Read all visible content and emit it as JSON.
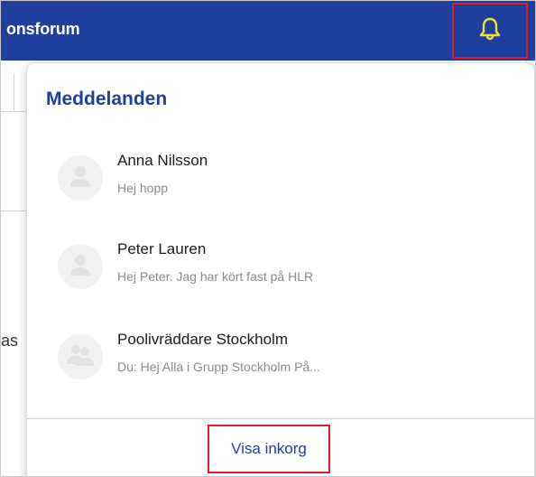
{
  "header": {
    "app_title": "onsforum",
    "bell_icon": "bell-icon",
    "bell_color": "#f5e12a",
    "bar_color": "#1f3f9e"
  },
  "background": {
    "partial_text": "as"
  },
  "notifications": {
    "title": "Meddelanden",
    "items": [
      {
        "name": "Anna Nilsson",
        "preview": "Hej hopp",
        "avatar_icon": "user-icon"
      },
      {
        "name": "Peter Lauren",
        "preview": "Hej Peter. Jag har kört fast på HLR",
        "avatar_icon": "user-icon"
      },
      {
        "name": "Poolivräddare Stockholm",
        "preview": "Du: Hej Alla i Grupp Stockholm På...",
        "avatar_icon": "group-icon"
      }
    ],
    "view_inbox_label": "Visa inkorg"
  },
  "highlight_color": "#e01e2b"
}
